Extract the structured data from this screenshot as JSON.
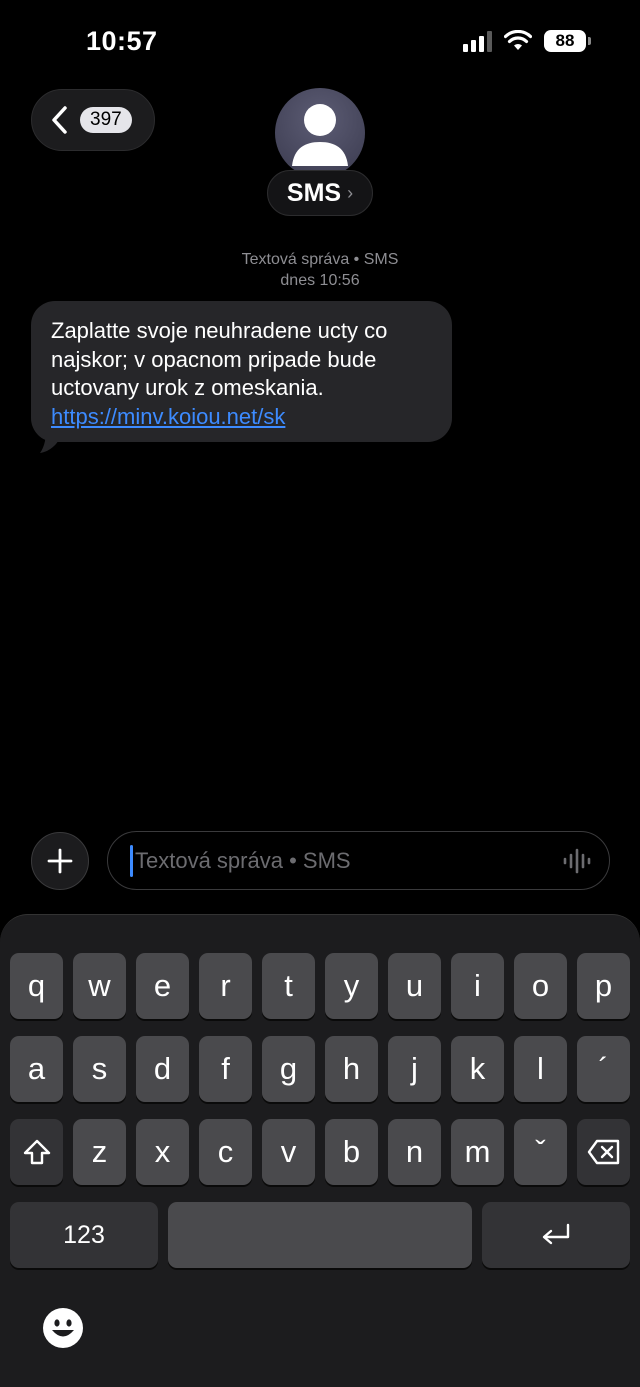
{
  "status_bar": {
    "time": "10:57",
    "battery": "88"
  },
  "header": {
    "unread_count": "397",
    "contact_name": "SMS",
    "contact_chevron": "›"
  },
  "thread": {
    "meta_line1": "Textová správa • SMS",
    "meta_line2": "dnes 10:56",
    "message": {
      "text": "Zaplatte svoje neuhradene ucty co najskor; v opacnom pripade bude uctovany urok z omeskania. ",
      "link": "https://minv.koiou.net/sk"
    }
  },
  "composer": {
    "placeholder": "Textová správa • SMS"
  },
  "keyboard": {
    "row1": [
      "q",
      "w",
      "e",
      "r",
      "t",
      "y",
      "u",
      "i",
      "o",
      "p"
    ],
    "row2": [
      "a",
      "s",
      "d",
      "f",
      "g",
      "h",
      "j",
      "k",
      "l",
      "´"
    ],
    "row3": [
      "z",
      "x",
      "c",
      "v",
      "b",
      "n",
      "m",
      "ˇ"
    ],
    "numbers_label": "123"
  },
  "icons": {
    "back": "chevron-left-icon",
    "avatar": "person-icon",
    "plus": "plus-icon",
    "mic": "waveform-icon",
    "shift": "shift-icon",
    "delete": "delete-icon",
    "return": "return-icon",
    "emoji": "emoji-icon",
    "signal": "cellular-signal-icon",
    "wifi": "wifi-icon"
  },
  "colors": {
    "link": "#3d8bff",
    "bubble": "#262629",
    "key": "#4a4a4d",
    "key_dark": "#333336"
  }
}
